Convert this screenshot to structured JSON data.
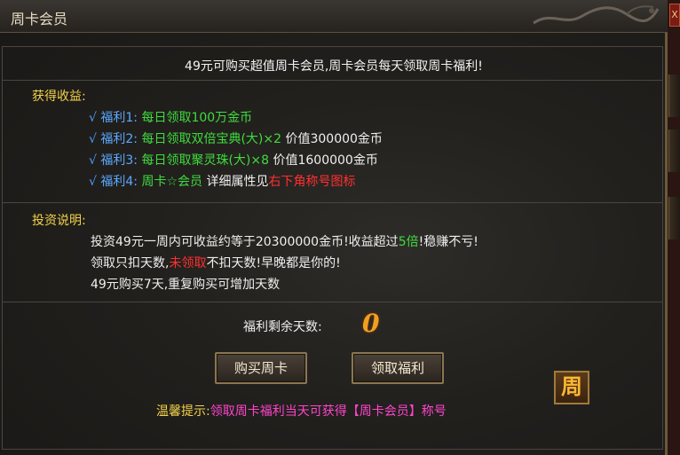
{
  "window": {
    "title": "周卡会员",
    "close_label": "X"
  },
  "headline": "49元可购买超值周卡会员,周卡会员每天领取周卡福利!",
  "benefits": {
    "title": "获得收益:",
    "items": [
      {
        "check": "√",
        "label": "福利1:",
        "desc": "每日领取100万金币",
        "extra": "",
        "tail": ""
      },
      {
        "check": "√",
        "label": "福利2:",
        "desc": "每日领取双倍宝典(大)×2",
        "extra": "价值300000金币",
        "tail": ""
      },
      {
        "check": "√",
        "label": "福利3:",
        "desc": "每日领取聚灵珠(大)×8",
        "extra": "价值1600000金币",
        "tail": ""
      },
      {
        "check": "√",
        "label": "福利4:",
        "desc": "周卡☆会员",
        "extra": "详细属性见",
        "tail": "右下角称号图标"
      }
    ]
  },
  "investment": {
    "title": "投资说明:",
    "line1_a": "投资49元一周内可收益约等于20300000金币!收益超过",
    "line1_b": "5倍",
    "line1_c": "!稳赚不亏!",
    "line2_a": "领取只扣天数,",
    "line2_b": "未领取",
    "line2_c": "不扣天数!早晚都是你的!",
    "line3": "49元购买7天,重复购买可增加天数"
  },
  "remaining": {
    "label": "福利剩余天数:",
    "value": "0"
  },
  "buttons": {
    "buy": "购买周卡",
    "claim": "领取福利"
  },
  "week_icon": "周",
  "tip": {
    "label": "温馨提示:",
    "text": "领取周卡福利当天可获得【周卡会员】称号"
  },
  "colors": {
    "accent_gold": "#f2d24a",
    "benefit_green": "#3edc3e",
    "label_blue": "#5aa8ff",
    "warn_red": "#ff3030",
    "tip_pink": "#ff44cc"
  }
}
